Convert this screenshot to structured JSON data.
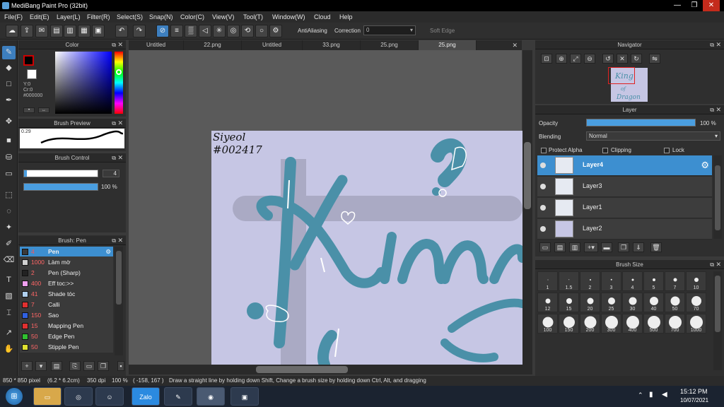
{
  "window": {
    "title": "MediBang Paint Pro (32bit)",
    "min": "—",
    "max": "❐",
    "close": "✕"
  },
  "menu": [
    "File(F)",
    "Edit(E)",
    "Layer(L)",
    "Filter(R)",
    "Select(S)",
    "Snap(N)",
    "Color(C)",
    "View(V)",
    "Tool(T)",
    "Window(W)",
    "Cloud",
    "Help"
  ],
  "toolbar": {
    "antialiasing": "AntiAliasing",
    "correction": "Correction",
    "correction_value": "0",
    "soft_edge": "Soft Edge"
  },
  "color_panel": {
    "title": "Color",
    "y": "Y:0",
    "cr": "Cr:0",
    "hex": "#000000",
    "primary": "#000000",
    "secondary": "#ffffff"
  },
  "brush_preview": {
    "title": "Brush Preview",
    "size": "0.29"
  },
  "brush_control": {
    "title": "Brush Control",
    "size_value": "4",
    "opacity_value": "100 %"
  },
  "brush_list": {
    "title": "Brush: Pen",
    "items": [
      {
        "size": "4",
        "name": "Pen",
        "color": "#3a3a3a"
      },
      {
        "size": "1000",
        "name": "Làm mờ",
        "color": "#d0d0d0"
      },
      {
        "size": "2",
        "name": "Pen (Sharp)",
        "color": "#222222"
      },
      {
        "size": "400",
        "name": "Eff toc:>>",
        "color": "#f0a0f0"
      },
      {
        "size": "41",
        "name": "Shade tóc",
        "color": "#b0d0f0"
      },
      {
        "size": "7",
        "name": "Calli",
        "color": "#e03030"
      },
      {
        "size": "150",
        "name": "Sao",
        "color": "#3060e0"
      },
      {
        "size": "15",
        "name": "Mapping Pen",
        "color": "#e03030"
      },
      {
        "size": "50",
        "name": "Edge Pen",
        "color": "#30c030"
      },
      {
        "size": "50",
        "name": "Stipple Pen",
        "color": "#e0e030"
      }
    ]
  },
  "tabs": [
    "Untitled",
    "22.png",
    "Untitled",
    "33.png",
    "25.png",
    "25.png"
  ],
  "canvas": {
    "signature": "Siyeol",
    "tag": "#002417",
    "word": "King"
  },
  "navigator": {
    "title": "Navigator"
  },
  "layer_panel": {
    "title": "Layer",
    "opacity_label": "Opacity",
    "opacity_value": "100 %",
    "blending_label": "Blending",
    "blending_value": "Normal",
    "protect_alpha": "Protect Alpha",
    "clipping": "Clipping",
    "lock": "Lock",
    "layers": [
      "Layer4",
      "Layer3",
      "Layer1",
      "Layer2"
    ]
  },
  "brush_size": {
    "title": "Brush Size",
    "sizes": [
      "1",
      "1.5",
      "2",
      "3",
      "4",
      "5",
      "7",
      "10",
      "12",
      "15",
      "20",
      "25",
      "30",
      "40",
      "50",
      "70",
      "100",
      "150",
      "200",
      "300",
      "400",
      "500",
      "700",
      "1000"
    ]
  },
  "status": {
    "dims": "850 * 850 pixel",
    "phys": "(6.2 * 6.2cm)",
    "dpi": "350 dpi",
    "zoom": "100 %",
    "coords": "( -158, 167 )",
    "hint": "Draw a straight line by holding down Shift, Change a brush size by holding down Ctrl, Alt, and dragging"
  },
  "taskbar": {
    "time": "15:12 PM",
    "date": "10/07/2021",
    "zalo": "Zalo"
  }
}
